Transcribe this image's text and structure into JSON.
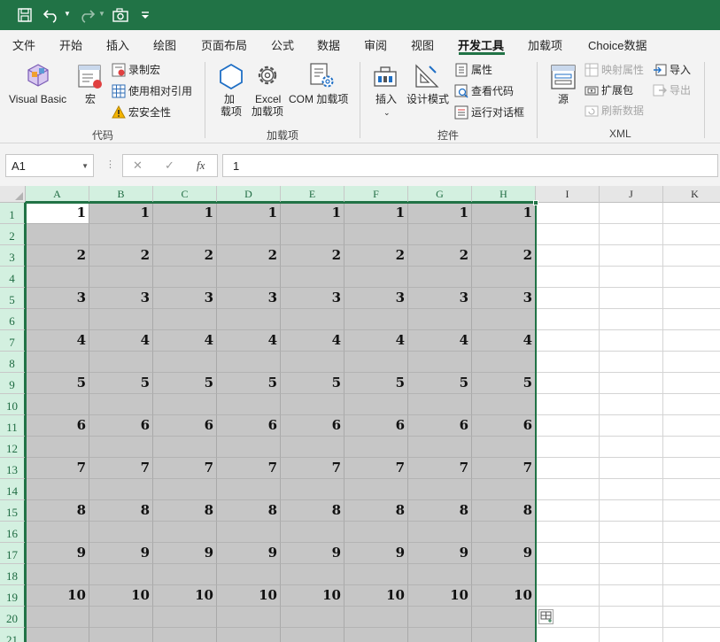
{
  "quick_access": {
    "items": [
      "save-icon",
      "undo-icon",
      "redo-icon",
      "camera-icon",
      "customize-toolbar-icon"
    ]
  },
  "menu": {
    "tabs": [
      "文件",
      "开始",
      "插入",
      "绘图",
      "页面布局",
      "公式",
      "数据",
      "审阅",
      "视图",
      "开发工具",
      "加载项",
      "Choice数据"
    ],
    "active": "开发工具"
  },
  "ribbon": {
    "code": {
      "visual_basic": "Visual Basic",
      "macros": "宏",
      "record_macro": "录制宏",
      "use_relative_refs": "使用相对引用",
      "macro_security": "宏安全性",
      "group_label": "代码"
    },
    "addins": {
      "addins_line1": "加",
      "addins_line2": "载项",
      "excel_addins_line1": "Excel",
      "excel_addins_line2": "加载项",
      "com_addins": "COM 加载项",
      "group_label": "加载项"
    },
    "controls": {
      "insert": "插入",
      "design_mode": "设计模式",
      "properties": "属性",
      "view_code": "查看代码",
      "run_dialog": "运行对话框",
      "group_label": "控件"
    },
    "xml": {
      "source": "源",
      "map_properties": "映射属性",
      "expansion_packs": "扩展包",
      "refresh_data": "刷新数据",
      "import": "导入",
      "export": "导出",
      "group_label": "XML"
    }
  },
  "formula_bar": {
    "name_box": "A1",
    "cancel": "✕",
    "enter": "✓",
    "fx": "fx",
    "value": "1"
  },
  "sheet": {
    "columns": [
      "A",
      "B",
      "C",
      "D",
      "E",
      "F",
      "G",
      "H",
      "I",
      "J",
      "K"
    ],
    "selected_columns": [
      "A",
      "B",
      "C",
      "D",
      "E",
      "F",
      "G",
      "H"
    ],
    "rows": [
      "1",
      "2",
      "3",
      "4",
      "5",
      "6",
      "7",
      "8",
      "9",
      "10",
      "11",
      "12",
      "13",
      "14",
      "15",
      "16",
      "17",
      "18",
      "19",
      "20",
      "21"
    ],
    "active_cell": "A1",
    "selection": "A1:H21",
    "cells": [
      [
        "1",
        "1",
        "1",
        "1",
        "1",
        "1",
        "1",
        "1",
        "",
        "",
        ""
      ],
      [
        "",
        "",
        "",
        "",
        "",
        "",
        "",
        "",
        "",
        "",
        ""
      ],
      [
        "2",
        "2",
        "2",
        "2",
        "2",
        "2",
        "2",
        "2",
        "",
        "",
        ""
      ],
      [
        "",
        "",
        "",
        "",
        "",
        "",
        "",
        "",
        "",
        "",
        ""
      ],
      [
        "3",
        "3",
        "3",
        "3",
        "3",
        "3",
        "3",
        "3",
        "",
        "",
        ""
      ],
      [
        "",
        "",
        "",
        "",
        "",
        "",
        "",
        "",
        "",
        "",
        ""
      ],
      [
        "4",
        "4",
        "4",
        "4",
        "4",
        "4",
        "4",
        "4",
        "",
        "",
        ""
      ],
      [
        "",
        "",
        "",
        "",
        "",
        "",
        "",
        "",
        "",
        "",
        ""
      ],
      [
        "5",
        "5",
        "5",
        "5",
        "5",
        "5",
        "5",
        "5",
        "",
        "",
        ""
      ],
      [
        "",
        "",
        "",
        "",
        "",
        "",
        "",
        "",
        "",
        "",
        ""
      ],
      [
        "6",
        "6",
        "6",
        "6",
        "6",
        "6",
        "6",
        "6",
        "",
        "",
        ""
      ],
      [
        "",
        "",
        "",
        "",
        "",
        "",
        "",
        "",
        "",
        "",
        ""
      ],
      [
        "7",
        "7",
        "7",
        "7",
        "7",
        "7",
        "7",
        "7",
        "",
        "",
        ""
      ],
      [
        "",
        "",
        "",
        "",
        "",
        "",
        "",
        "",
        "",
        "",
        ""
      ],
      [
        "8",
        "8",
        "8",
        "8",
        "8",
        "8",
        "8",
        "8",
        "",
        "",
        ""
      ],
      [
        "",
        "",
        "",
        "",
        "",
        "",
        "",
        "",
        "",
        "",
        ""
      ],
      [
        "9",
        "9",
        "9",
        "9",
        "9",
        "9",
        "9",
        "9",
        "",
        "",
        ""
      ],
      [
        "",
        "",
        "",
        "",
        "",
        "",
        "",
        "",
        "",
        "",
        ""
      ],
      [
        "10",
        "10",
        "10",
        "10",
        "10",
        "10",
        "10",
        "10",
        "",
        "",
        ""
      ],
      [
        "",
        "",
        "",
        "",
        "",
        "",
        "",
        "",
        "",
        "",
        ""
      ],
      [
        "",
        "",
        "",
        "",
        "",
        "",
        "",
        "",
        "",
        "",
        ""
      ]
    ]
  },
  "colors": {
    "brand": "#217346",
    "selection_fill": "#c6c6c6",
    "header_selected": "#d3f0e0"
  }
}
